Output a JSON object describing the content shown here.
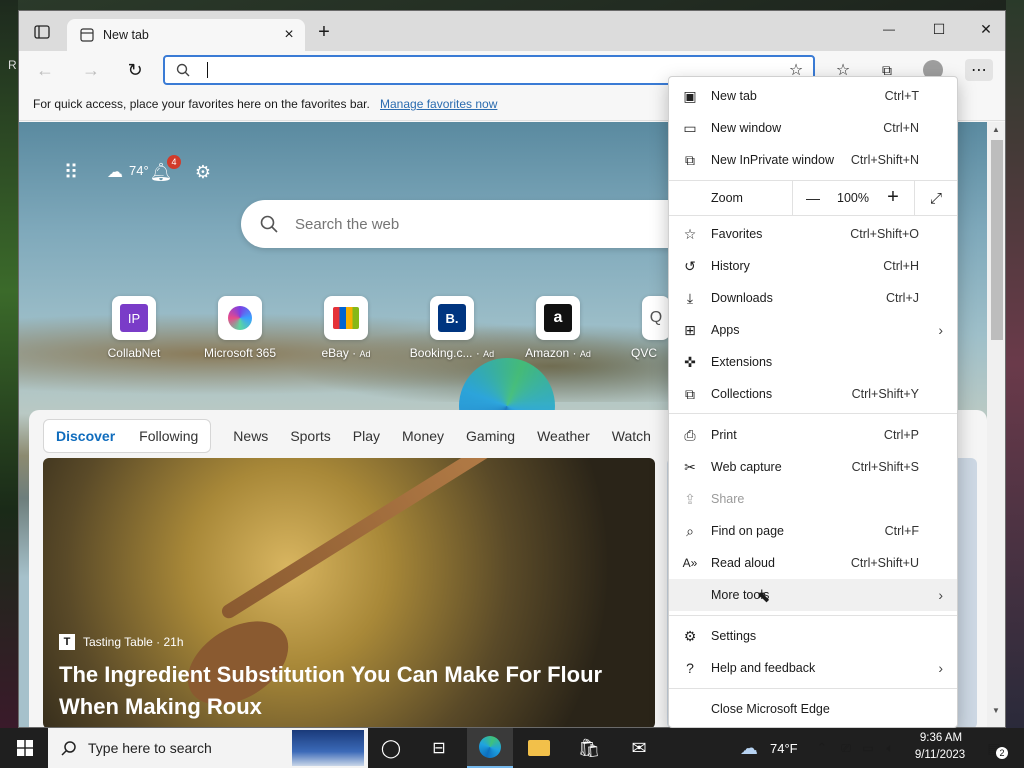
{
  "desktop": {
    "left_letter": "R"
  },
  "browser": {
    "tab": {
      "title": "New tab",
      "close": "×",
      "new_tab": "+"
    },
    "window_controls": {
      "minimize": "—",
      "maximize": "☐",
      "close": "✕"
    },
    "address_bar": {
      "value": "",
      "placeholder": ""
    },
    "favorites_bar": {
      "message": "For quick access, place your favorites here on the favorites bar.",
      "link": "Manage favorites now"
    }
  },
  "newtab": {
    "weather_temp": "74°",
    "notification_count": "4",
    "search_placeholder": "Search the web",
    "quick_links": [
      {
        "label": "CollabNet",
        "icon_text": "IP",
        "ad": ""
      },
      {
        "label": "Microsoft 365",
        "icon_text": "",
        "ad": ""
      },
      {
        "label": "eBay",
        "icon_text": "",
        "ad": "Ad"
      },
      {
        "label": "Booking.c...",
        "icon_text": "B.",
        "ad": "Ad"
      },
      {
        "label": "Amazon",
        "icon_text": "a",
        "ad": "Ad"
      },
      {
        "label": "QVC",
        "icon_text": "Q",
        "ad": ""
      }
    ],
    "feed_tabs": {
      "discover": "Discover",
      "following": "Following",
      "items": [
        "News",
        "Sports",
        "Play",
        "Money",
        "Gaming",
        "Weather",
        "Watch"
      ]
    },
    "card": {
      "source": "Tasting Table · 21h",
      "headline_line1": "The Ingredient Substitution You Can Make For Flour",
      "headline_line2": "When Making Roux"
    }
  },
  "menu": {
    "items": [
      {
        "label": "New tab",
        "shortcut": "Ctrl+T",
        "icon": "new-tab-icon"
      },
      {
        "label": "New window",
        "shortcut": "Ctrl+N",
        "icon": "new-window-icon"
      },
      {
        "label": "New InPrivate window",
        "shortcut": "Ctrl+Shift+N",
        "icon": "inprivate-icon"
      }
    ],
    "zoom": {
      "label": "Zoom",
      "minus": "—",
      "value": "100%",
      "plus": "+"
    },
    "items2": [
      {
        "label": "Favorites",
        "shortcut": "Ctrl+Shift+O"
      },
      {
        "label": "History",
        "shortcut": "Ctrl+H"
      },
      {
        "label": "Downloads",
        "shortcut": "Ctrl+J"
      },
      {
        "label": "Apps",
        "shortcut": ""
      },
      {
        "label": "Extensions",
        "shortcut": ""
      },
      {
        "label": "Collections",
        "shortcut": "Ctrl+Shift+Y"
      }
    ],
    "items3": [
      {
        "label": "Print",
        "shortcut": "Ctrl+P"
      },
      {
        "label": "Web capture",
        "shortcut": "Ctrl+Shift+S"
      },
      {
        "label": "Share",
        "shortcut": ""
      },
      {
        "label": "Find on page",
        "shortcut": "Ctrl+F"
      },
      {
        "label": "Read aloud",
        "shortcut": "Ctrl+Shift+U"
      },
      {
        "label": "More tools",
        "shortcut": ""
      }
    ],
    "items4": [
      {
        "label": "Settings"
      },
      {
        "label": "Help and feedback"
      }
    ],
    "close": "Close Microsoft Edge"
  },
  "taskbar": {
    "search_placeholder": "Type here to search",
    "weather": "74°F",
    "time": "9:36 AM",
    "date": "9/11/2023",
    "notifications": "2"
  }
}
